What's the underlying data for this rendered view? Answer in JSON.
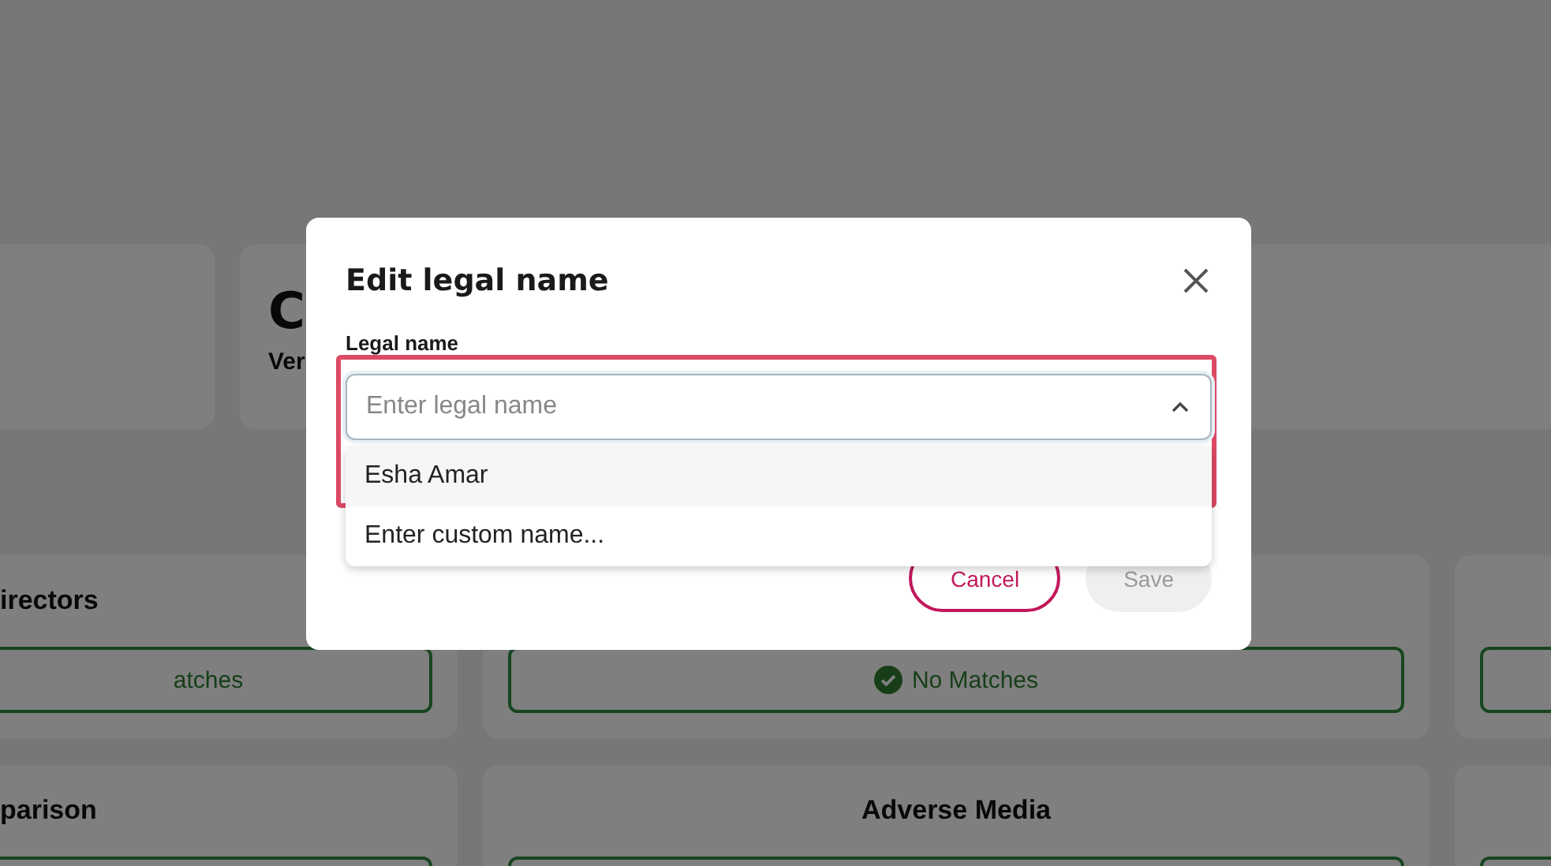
{
  "background": {
    "header_card": {
      "title": "C",
      "subtitle": "Ver"
    },
    "check_cards": [
      {
        "kind": "check",
        "title": "irectors",
        "status": "atches"
      },
      {
        "kind": "check",
        "status": "No Matches",
        "status_icon": true
      },
      {
        "kind": "check"
      },
      {
        "kind": "check",
        "title": "parison"
      },
      {
        "kind": "check",
        "title": "Adverse Media",
        "title_centered": true
      },
      {
        "kind": "check"
      }
    ]
  },
  "dialog": {
    "title": "Edit legal name",
    "field_label": "Legal name",
    "select": {
      "placeholder": "Enter legal name",
      "expanded": true,
      "options": [
        {
          "label": "Esha Amar",
          "selected": true
        },
        {
          "label": "Enter custom name...",
          "selected": false
        }
      ]
    },
    "highlight_frame": true,
    "buttons": [
      {
        "label": "Cancel",
        "kind": "secondary",
        "disabled": false
      },
      {
        "label": "Save",
        "kind": "primary",
        "disabled": true
      }
    ]
  }
}
